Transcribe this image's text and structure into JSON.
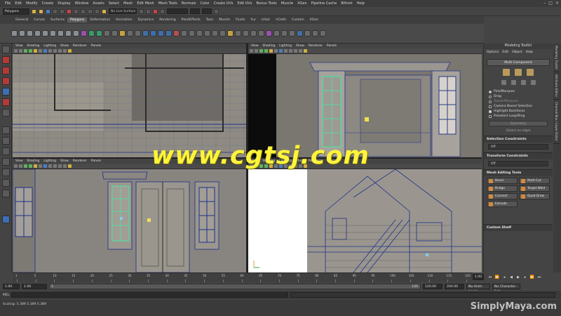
{
  "menubar": {
    "items": [
      "File",
      "Edit",
      "Modify",
      "Create",
      "Display",
      "Window",
      "Assets",
      "Select",
      "Mesh",
      "Edit Mesh",
      "Mesh Tools",
      "Normals",
      "Color",
      "Create UVs",
      "Edit UVs",
      "Bonus Tools",
      "Muscle",
      "XGen",
      "Pipeline Cache",
      "Bifrost",
      "Help"
    ]
  },
  "statusline": {
    "mode": "Polygons",
    "live_surface": "No Live Surface"
  },
  "shelf": {
    "tabs": [
      "General",
      "Curves",
      "Surfaces",
      "Polygons",
      "Deformation",
      "Animation",
      "Dynamics",
      "Rendering",
      "PaintEffects",
      "Toon",
      "Muscle",
      "Fluids",
      "Fur",
      "nHair",
      "nCloth",
      "Custom",
      "XGen"
    ],
    "active_tab": "Polygons"
  },
  "viewport": {
    "menu": [
      "View",
      "Shading",
      "Lighting",
      "Show",
      "Renderer",
      "Panels"
    ]
  },
  "modeling_toolkit": {
    "title": "Modeling Toolkit",
    "menu": [
      "Options",
      "Edit",
      "Object",
      "Help"
    ],
    "multi_component": "Multi-Component",
    "selection_modes": [
      {
        "label": "Pick/Marquee",
        "selected": true
      },
      {
        "label": "Drag",
        "selected": false
      },
      {
        "label": "Tweak/Marquee",
        "selected": false
      }
    ],
    "checks": [
      {
        "label": "Camera Based Selection",
        "checked": false
      },
      {
        "label": "Highlight Backfaces",
        "checked": true
      },
      {
        "label": "Preselect Loop/Ring",
        "checked": false
      }
    ],
    "symmetry": "Symmetry",
    "select_hint": "(Select an edge)",
    "selection_constraints_title": "Selection Constraints",
    "selection_constraints_value": "Off",
    "transform_constraints_title": "Transform Constraints",
    "transform_constraints_value": "Off",
    "mesh_editing_title": "Mesh Editing Tools",
    "tools": [
      "Bevel",
      "Multi-Cut",
      "Bridge",
      "Target Weld",
      "Connect",
      "Quad Draw",
      "Extrude"
    ],
    "custom_shelf": "Custom Shelf"
  },
  "side_tabs": [
    "Modeling Toolkit",
    "Attribute Editor",
    "Channel Box / Layer Editor"
  ],
  "timeslider": {
    "ticks": [
      "1",
      "5",
      "10",
      "15",
      "20",
      "25",
      "30",
      "35",
      "40",
      "45",
      "50",
      "55",
      "60",
      "65",
      "70",
      "75",
      "80",
      "85",
      "90",
      "95",
      "100",
      "105",
      "110",
      "115",
      "120"
    ],
    "current_frame": "1.00"
  },
  "range": {
    "start": "1.00",
    "start2": "1.00",
    "track_value": "1",
    "track_end": "120",
    "end": "120.00",
    "end2": "200.00",
    "anim_layer": "No Anim Layer",
    "char_set": "No Character Set"
  },
  "command": {
    "label": "MEL"
  },
  "help": {
    "text": "Scaling:  5.389    5.389    5.389"
  },
  "watermark": "www.cgtsj.com",
  "brand": "SimplyMaya.com"
}
